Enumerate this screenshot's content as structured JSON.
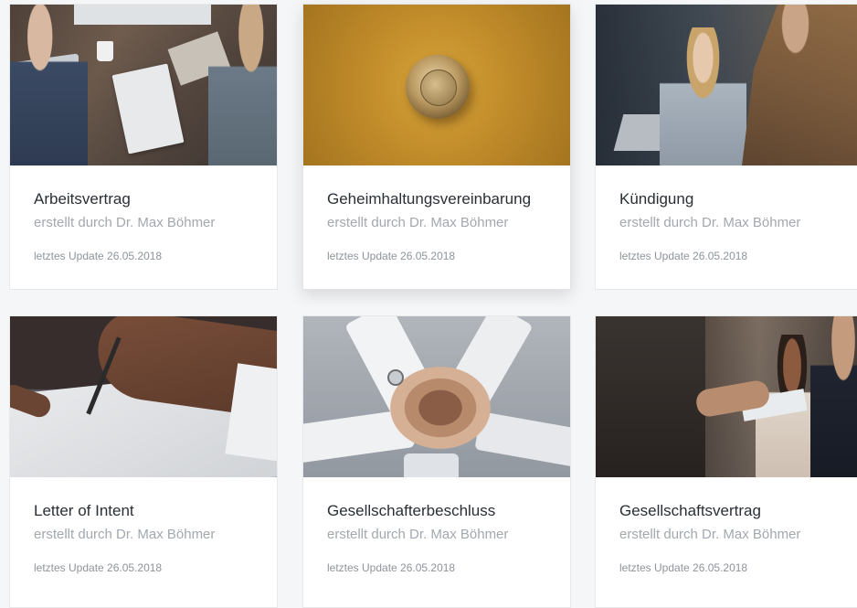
{
  "cards": [
    {
      "title": "Arbeitsvertrag",
      "author": "erstellt durch Dr. Max Böhmer",
      "updated": "letztes Update 26.05.2018"
    },
    {
      "title": "Geheimhaltungsvereinbarung",
      "author": "erstellt durch Dr. Max Böhmer",
      "updated": "letztes Update 26.05.2018"
    },
    {
      "title": "Kündigung",
      "author": "erstellt durch Dr. Max Böhmer",
      "updated": "letztes Update 26.05.2018"
    },
    {
      "title": "Letter of Intent",
      "author": "erstellt durch Dr. Max Böhmer",
      "updated": "letztes Update 26.05.2018"
    },
    {
      "title": "Gesellschafterbeschluss",
      "author": "erstellt durch Dr. Max Böhmer",
      "updated": "letztes Update 26.05.2018"
    },
    {
      "title": "Gesellschaftsvertrag",
      "author": "erstellt durch Dr. Max Böhmer",
      "updated": "letztes Update 26.05.2018"
    }
  ],
  "colors": {
    "card_background": "#ffffff",
    "page_background": "#f5f6f7",
    "title_text": "#2a2f36",
    "author_text": "#a3a8ae",
    "updated_text": "#8e949b"
  }
}
